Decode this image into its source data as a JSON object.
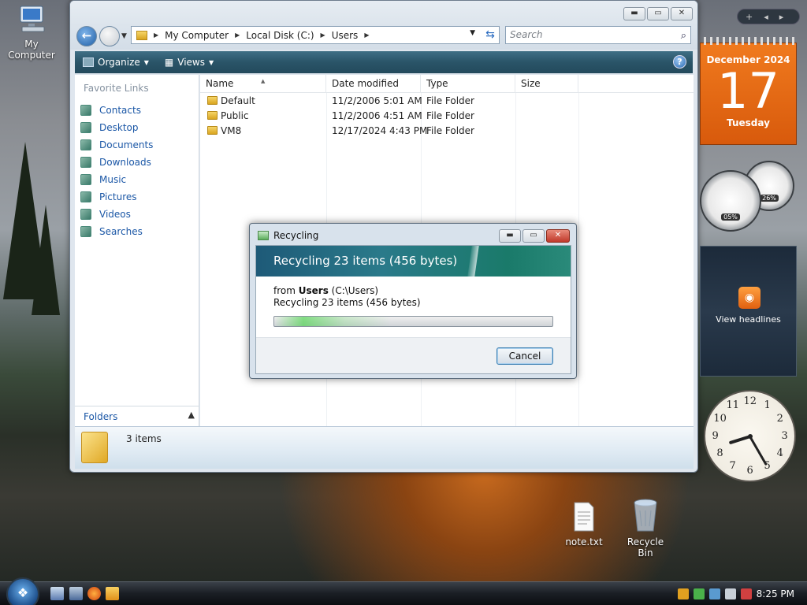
{
  "desktop": {
    "icons": [
      {
        "label": "My Computer"
      },
      {
        "label": "note.txt"
      },
      {
        "label": "Recycle Bin"
      }
    ]
  },
  "explorer": {
    "caption_buttons": {
      "minimize": "▬",
      "maximize": "▭",
      "close": "✕"
    },
    "address": {
      "breadcrumbs": [
        "My Computer",
        "Local Disk (C:)",
        "Users"
      ]
    },
    "search": {
      "placeholder": "Search"
    },
    "commands": {
      "organize": "Organize",
      "views": "Views",
      "help": "?"
    },
    "nav": {
      "header": "Favorite Links",
      "links": [
        "Contacts",
        "Desktop",
        "Documents",
        "Downloads",
        "Music",
        "Pictures",
        "Videos",
        "Searches"
      ],
      "folders_label": "Folders"
    },
    "columns": [
      "Name",
      "Date modified",
      "Type",
      "Size"
    ],
    "files": [
      {
        "name": "Default",
        "date": "11/2/2006 5:01 AM",
        "type": "File Folder",
        "size": ""
      },
      {
        "name": "Public",
        "date": "11/2/2006 4:51 AM",
        "type": "File Folder",
        "size": ""
      },
      {
        "name": "VM8",
        "date": "12/17/2024 4:43 PM",
        "type": "File Folder",
        "size": ""
      }
    ],
    "details": {
      "count": "3 items"
    }
  },
  "dialog": {
    "title": "Recycling",
    "banner": "Recycling 23 items (456 bytes)",
    "from_prefix": "from ",
    "from_name": "Users",
    "from_path": " (C:\\Users)",
    "status": "Recycling 23 items (456 bytes)",
    "progress": 0.42,
    "cancel": "Cancel"
  },
  "gadgets": {
    "sidebar_controls": {
      "add": "+",
      "prev": "◂",
      "next": "▸"
    },
    "calendar": {
      "month": "December 2024",
      "day": "17",
      "weekday": "Tuesday"
    },
    "cpu": {
      "small": "26%",
      "large": "05%"
    },
    "feed": {
      "text": "View headlines"
    },
    "clock": {
      "hour": 8,
      "minute": 25,
      "numbers": [
        "12",
        "1",
        "2",
        "3",
        "4",
        "5",
        "6",
        "7",
        "8",
        "9",
        "10",
        "11"
      ]
    }
  },
  "taskbar": {
    "time": "8:25 PM"
  },
  "colors": {
    "accent": "#2a5468",
    "calendar": "#e8681a",
    "link": "#1b57a6"
  }
}
